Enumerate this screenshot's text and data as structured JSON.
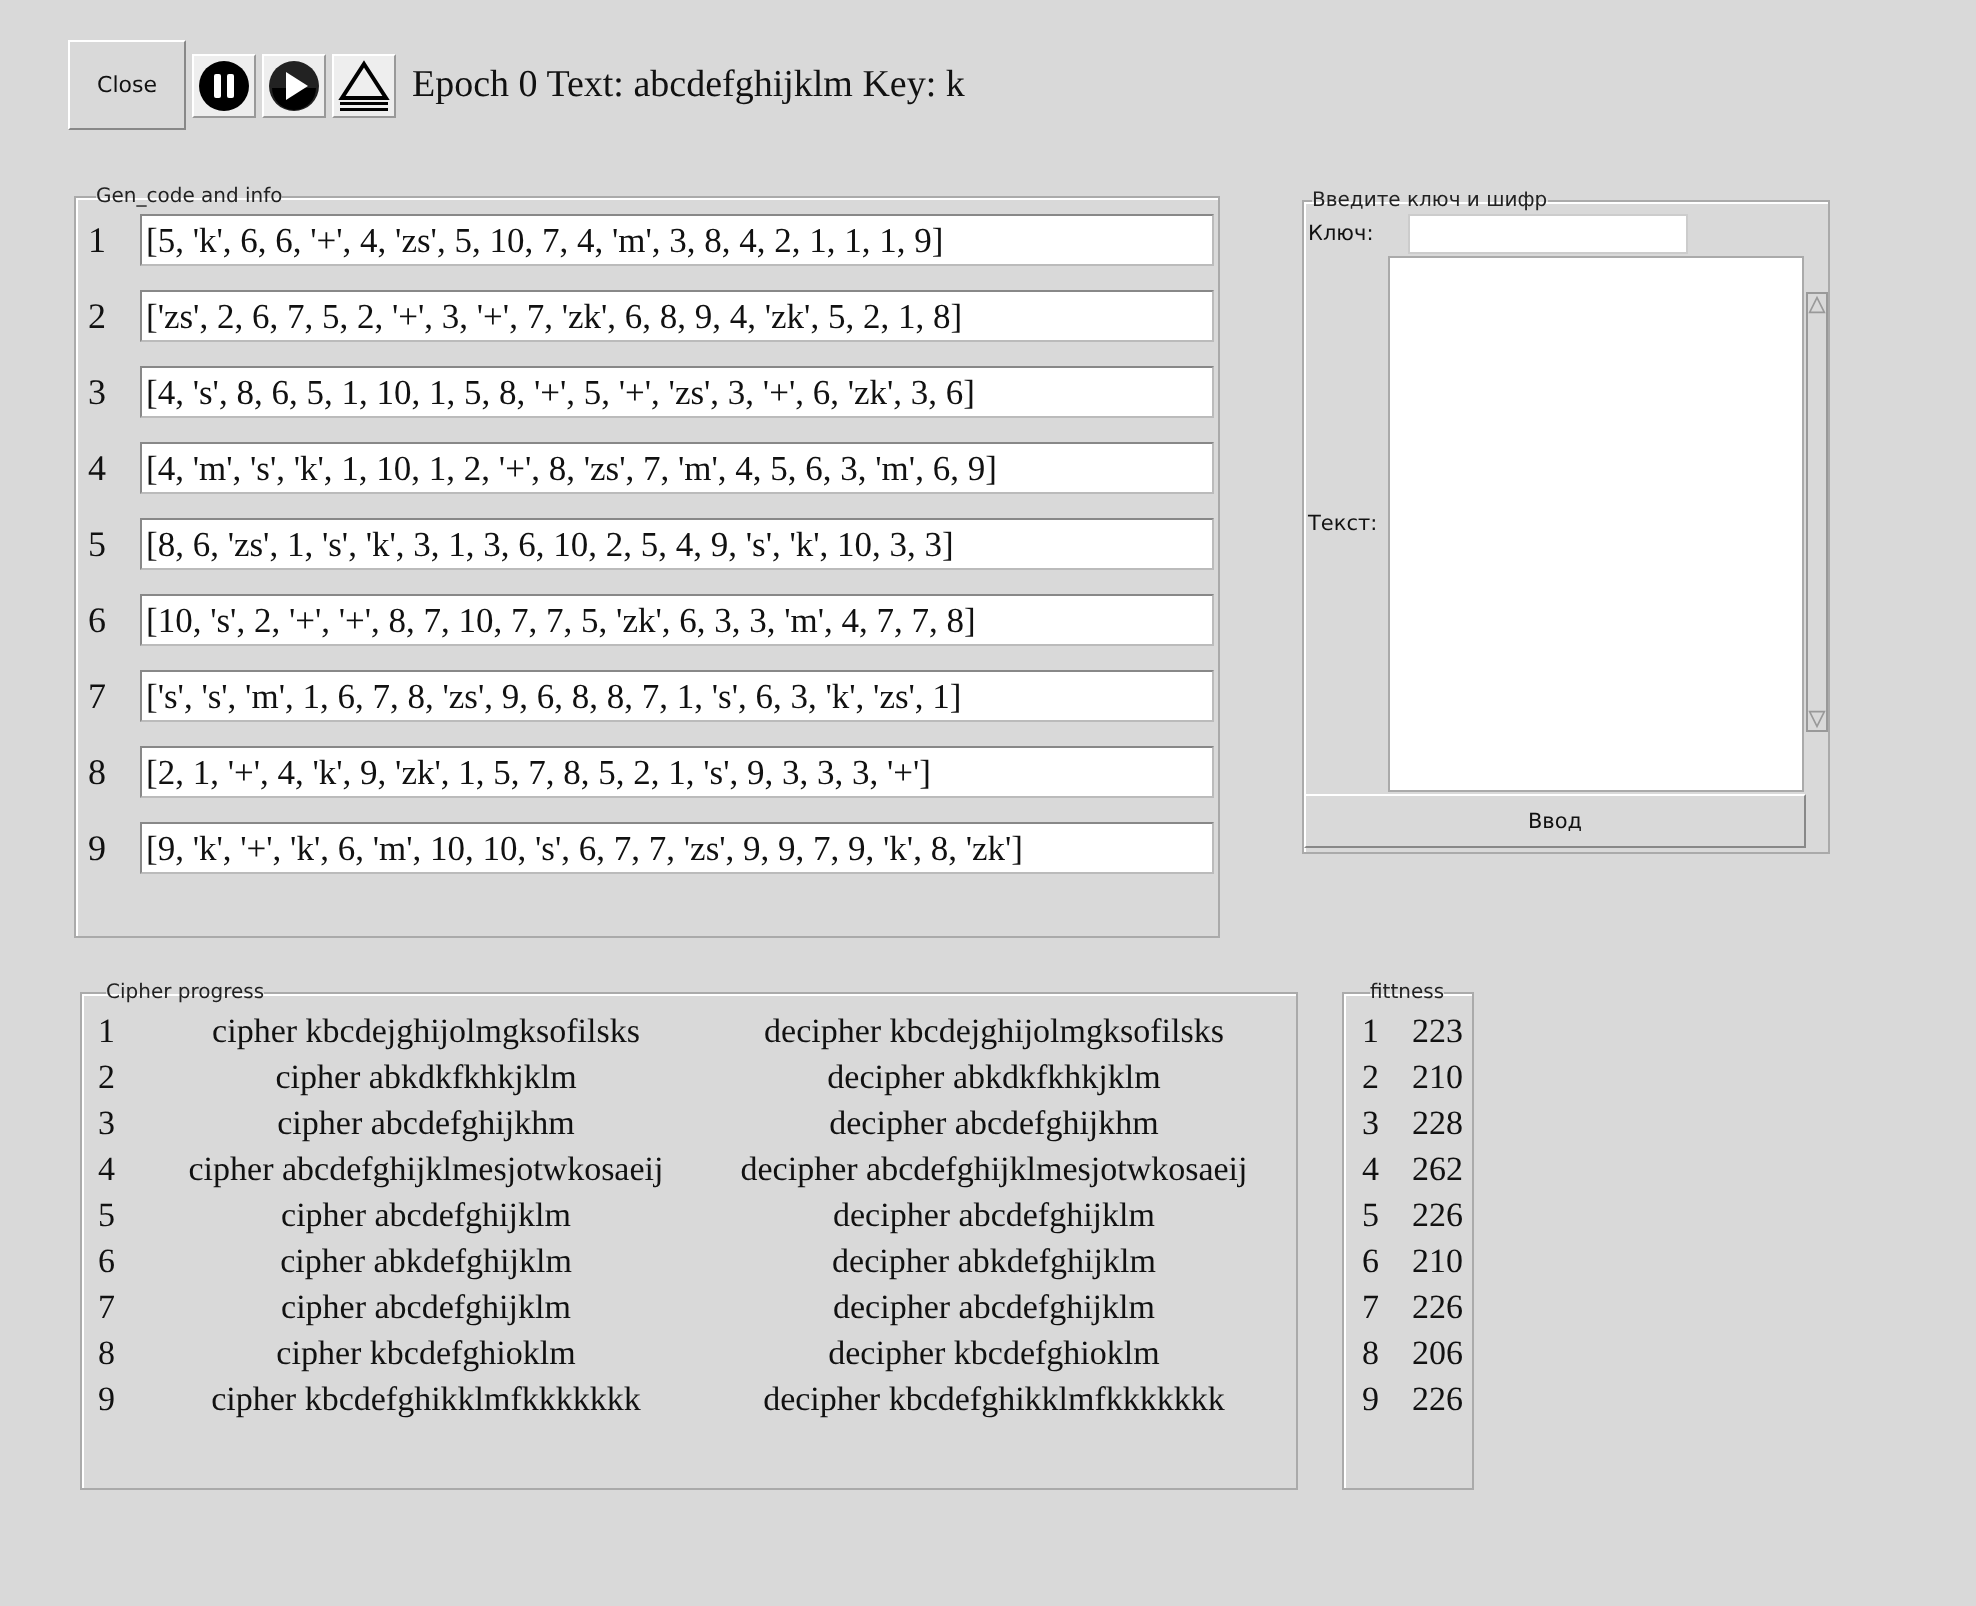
{
  "toolbar": {
    "close_button": "Close",
    "status": "Epoch 0 Text: abcdefghijklm Key: k"
  },
  "gen_code": {
    "title": "Gen_code and info",
    "rows": [
      {
        "index": "1",
        "code": "[5, 'k', 6, 6, '+', 4, 'zs', 5, 10, 7, 4, 'm', 3, 8, 4, 2, 1, 1, 1, 9]"
      },
      {
        "index": "2",
        "code": "['zs', 2, 6, 7, 5, 2, '+', 3, '+', 7, 'zk', 6, 8, 9, 4, 'zk', 5, 2, 1, 8]"
      },
      {
        "index": "3",
        "code": "[4, 's', 8, 6, 5, 1, 10, 1, 5, 8, '+', 5, '+', 'zs', 3, '+', 6, 'zk', 3, 6]"
      },
      {
        "index": "4",
        "code": "[4, 'm', 's', 'k', 1, 10, 1, 2, '+', 8, 'zs', 7, 'm', 4, 5, 6, 3, 'm', 6, 9]"
      },
      {
        "index": "5",
        "code": "[8, 6, 'zs', 1, 's', 'k', 3, 1, 3, 6, 10, 2, 5, 4, 9, 's', 'k', 10, 3, 3]"
      },
      {
        "index": "6",
        "code": "[10, 's', 2, '+', '+', 8, 7, 10, 7, 7, 5, 'zk', 6, 3, 3, 'm', 4, 7, 7, 8]"
      },
      {
        "index": "7",
        "code": "['s', 's', 'm', 1, 6, 7, 8, 'zs', 9, 6, 8, 8, 7, 1, 's', 6, 3, 'k', 'zs', 1]"
      },
      {
        "index": "8",
        "code": "[2, 1, '+', 4, 'k', 9, 'zk', 1, 5, 7, 8, 5, 2, 1, 's', 9, 3, 3, 3, '+']"
      },
      {
        "index": "9",
        "code": "[9, 'k', '+', 'k', 6, 'm', 10, 10, 's', 6, 7, 7, 'zs', 9, 9, 7, 9, 'k', 8, 'zk']"
      }
    ]
  },
  "input_panel": {
    "title": "Введите ключ и шифр",
    "key_label": "Ключ:",
    "text_label": "Текст:",
    "submit_button": "Ввод"
  },
  "cipher_progress": {
    "title": "Cipher progress",
    "rows": [
      {
        "index": "1",
        "cipher": "cipher kbcdejghijolmgksofilsks",
        "decipher": "decipher kbcdejghijolmgksofilsks"
      },
      {
        "index": "2",
        "cipher": "cipher abkdkfkhkjklm",
        "decipher": "decipher abkdkfkhkjklm"
      },
      {
        "index": "3",
        "cipher": "cipher abcdefghijkhm",
        "decipher": "decipher abcdefghijkhm"
      },
      {
        "index": "4",
        "cipher": "cipher abcdefghijklmesjotwkosaeij",
        "decipher": "decipher abcdefghijklmesjotwkosaeij"
      },
      {
        "index": "5",
        "cipher": "cipher abcdefghijklm",
        "decipher": "decipher abcdefghijklm"
      },
      {
        "index": "6",
        "cipher": "cipher abkdefghijklm",
        "decipher": "decipher abkdefghijklm"
      },
      {
        "index": "7",
        "cipher": "cipher abcdefghijklm",
        "decipher": "decipher abcdefghijklm"
      },
      {
        "index": "8",
        "cipher": "cipher kbcdefghioklm",
        "decipher": "decipher kbcdefghioklm"
      },
      {
        "index": "9",
        "cipher": "cipher kbcdefghikklmfkkkkkkk",
        "decipher": "decipher kbcdefghikklmfkkkkkkk"
      }
    ]
  },
  "fitness": {
    "title": "fittness",
    "rows": [
      {
        "index": "1",
        "value": "223"
      },
      {
        "index": "2",
        "value": "210"
      },
      {
        "index": "3",
        "value": "228"
      },
      {
        "index": "4",
        "value": "262"
      },
      {
        "index": "5",
        "value": "226"
      },
      {
        "index": "6",
        "value": "210"
      },
      {
        "index": "7",
        "value": "226"
      },
      {
        "index": "8",
        "value": "206"
      },
      {
        "index": "9",
        "value": "226"
      }
    ]
  }
}
